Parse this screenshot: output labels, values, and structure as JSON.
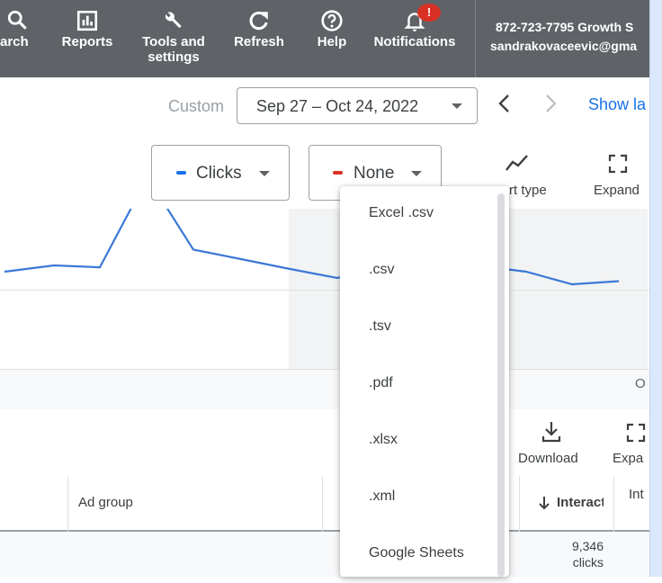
{
  "header": {
    "nav": [
      {
        "label": "arch",
        "icon": "search-icon"
      },
      {
        "label": "Reports",
        "icon": "reports-icon"
      },
      {
        "label": "Tools and settings",
        "icon": "wrench-icon"
      },
      {
        "label": "Refresh",
        "icon": "refresh-icon"
      },
      {
        "label": "Help",
        "icon": "help-icon"
      },
      {
        "label": "Notifications",
        "icon": "bell-icon"
      }
    ],
    "notification_badge": "!",
    "account_line1": "872-723-7795 Growth S",
    "account_line2": "sandrakovaceevic@gma"
  },
  "date_bar": {
    "custom_label": "Custom",
    "date_range": "Sep 27 – Oct 24, 2022",
    "show_last_label": "Show la"
  },
  "chart_controls": {
    "metric1_label": "Clicks",
    "metric1_color": "#1a73e8",
    "metric2_label": "None",
    "metric2_color": "#d93025",
    "chart_type_label": "rt type",
    "expand_label": "Expand"
  },
  "chart_data": {
    "type": "line",
    "series": [
      {
        "name": "Clicks",
        "color": "#3c78d8",
        "values": [
          1,
          1.1,
          1.07,
          2.5,
          1.35,
          1.2,
          1.05,
          0.9,
          1.1,
          1.2,
          1.1,
          1.0,
          0.8,
          0.85
        ]
      }
    ],
    "axis_tick_visible": "O"
  },
  "table_toolbar": {
    "download_label": "Download",
    "expand_label": "Expa"
  },
  "table": {
    "columns": [
      "Ad group",
      "Interact",
      "Int"
    ],
    "rows": [
      {
        "interactions": "9,346",
        "interactions_unit": "clicks"
      }
    ]
  },
  "download_menu": {
    "items": [
      "Excel .csv",
      ".csv",
      ".tsv",
      ".pdf",
      ".xlsx",
      ".xml",
      "Google Sheets"
    ]
  }
}
